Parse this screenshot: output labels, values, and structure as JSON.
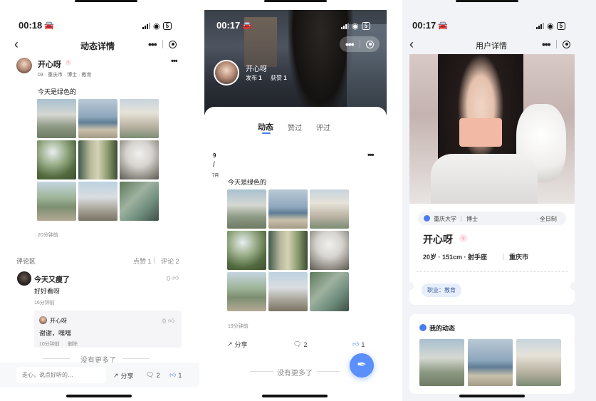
{
  "panel1": {
    "status_time": "00:18",
    "battery": "5",
    "nav_title": "动态详情",
    "post": {
      "author": "开心呀",
      "meta": "03 · 重庆市 · 博士 · 教育",
      "content": "今天是绿色的",
      "time_ago": "20分钟前"
    },
    "comments_section": {
      "title": "评论区",
      "likes": "点赞 1",
      "comments": "评论 2"
    },
    "comment": {
      "author": "今天又瘦了",
      "like_count": "0",
      "text": "好好看呀",
      "time": "16分钟前"
    },
    "reply": {
      "author": "开心呀",
      "like_count": "0",
      "text": "谢谢，嘿嘿",
      "time": "10分钟前",
      "delete": "删除"
    },
    "no_more": "没有更多了",
    "input_placeholder": "走心，说点好听的…",
    "share_label": "分享",
    "comment_count": "2",
    "like_count": "1"
  },
  "panel2": {
    "status_time": "00:17",
    "battery": "5",
    "profile": {
      "name": "开心呀",
      "posts_label": "发布",
      "posts_value": "1",
      "likes_label": "获赞",
      "likes_value": "1"
    },
    "tabs": [
      "动态",
      "赞过",
      "评过"
    ],
    "date_day": "9",
    "date_slash": "/",
    "date_month": "7月",
    "post_content": "今天是绿色的",
    "time_ago": "19分钟前",
    "share_label": "分享",
    "comment_count": "2",
    "like_count": "1",
    "no_more": "没有更多了"
  },
  "panel3": {
    "status_time": "00:17",
    "battery": "5",
    "nav_title": "用户详情",
    "school": "重庆大学",
    "degree": "博士",
    "study_mode": "· 全日制",
    "name": "开心呀",
    "stats": "20岁 · 151cm · 射手座",
    "city": "重庆市",
    "job": "职业：教育",
    "my_posts_title": "我的动态"
  },
  "colors": {
    "accent_blue": "#4a7cf0",
    "gender_badge": "#f36a7a",
    "fab": "#5b8ff9",
    "tag_bg": "#e6eefc"
  }
}
